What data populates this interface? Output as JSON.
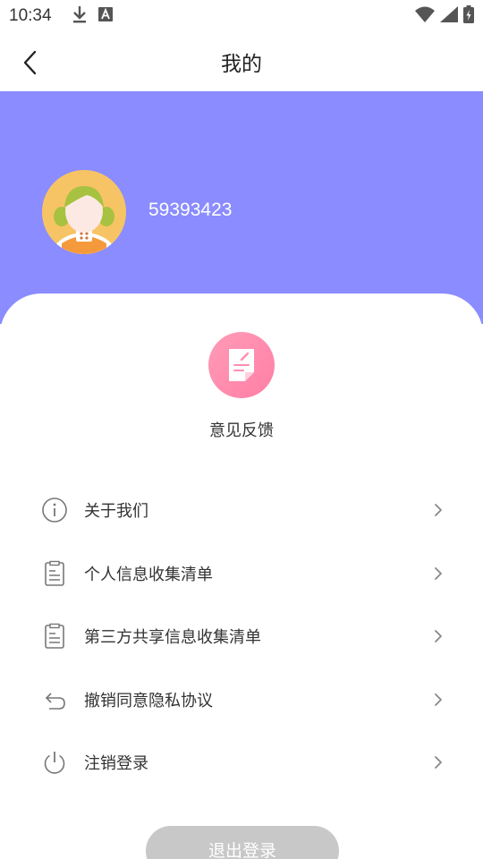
{
  "status_bar": {
    "time": "10:34"
  },
  "header": {
    "title": "我的"
  },
  "profile": {
    "user_id": "59393423",
    "header_color": "#8a8cff"
  },
  "feedback": {
    "label": "意见反馈"
  },
  "menu": {
    "items": [
      {
        "label": "关于我们",
        "icon": "info-icon"
      },
      {
        "label": "个人信息收集清单",
        "icon": "document-list-icon"
      },
      {
        "label": "第三方共享信息收集清单",
        "icon": "document-list-icon"
      },
      {
        "label": "撤销同意隐私协议",
        "icon": "undo-icon"
      },
      {
        "label": "注销登录",
        "icon": "power-icon"
      }
    ]
  },
  "logout": {
    "label": "退出登录"
  }
}
